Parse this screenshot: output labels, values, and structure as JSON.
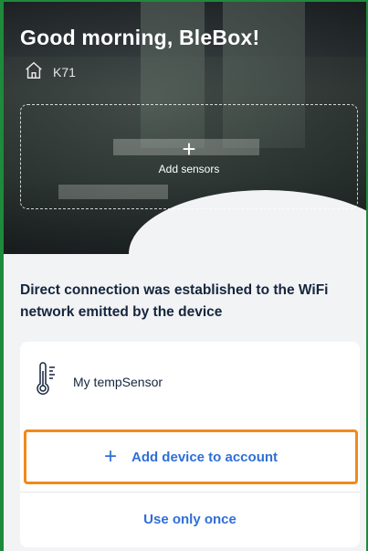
{
  "header": {
    "greeting": "Good morning, BleBox!",
    "location": "K71",
    "home_icon": "home-icon"
  },
  "add_sensors": {
    "plus": "+",
    "label": "Add sensors"
  },
  "main": {
    "heading": "Direct connection was established to the WiFi network emitted by the device"
  },
  "device": {
    "name": "My tempSensor",
    "icon": "thermometer-icon"
  },
  "actions": {
    "add_plus": "+",
    "add_label": "Add device to account",
    "once_label": "Use only once"
  },
  "colors": {
    "accent_blue": "#2f6fd6",
    "highlight_orange": "#f08a1c",
    "frame_green": "#1e8a3c",
    "heading_navy": "#15263d"
  }
}
